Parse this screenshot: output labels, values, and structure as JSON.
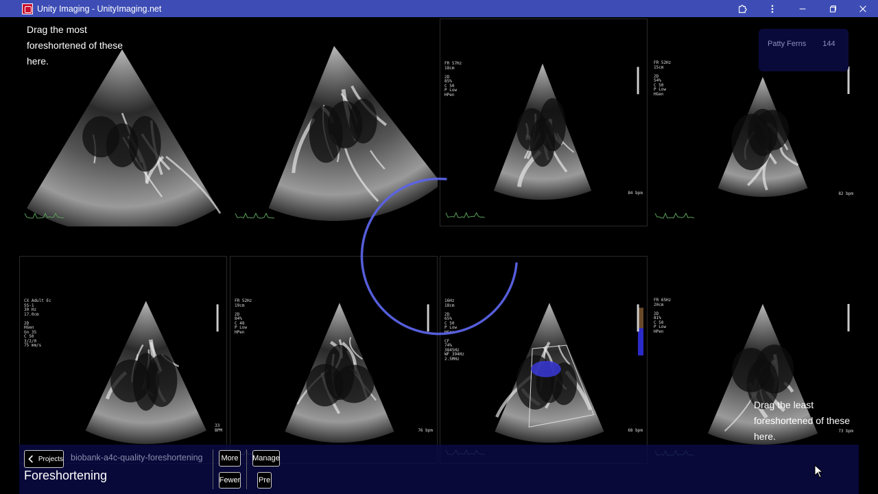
{
  "window": {
    "title": "Unity Imaging - UnityImaging.net",
    "buttons": [
      "extensions-icon",
      "more-vert-icon",
      "minimize-icon",
      "maximize-icon",
      "close-icon"
    ]
  },
  "hints": {
    "top": "Drag the most foreshortened of these here.",
    "bottom": "Drag the least foreshortened of these here."
  },
  "user": {
    "name": "Patty Ferns",
    "count": "144"
  },
  "tiles": [
    {
      "id": 1,
      "readout": "",
      "bpm": ""
    },
    {
      "id": 2,
      "readout": "",
      "bpm": ""
    },
    {
      "id": 3,
      "readout": "FR 57Hz\n18cm\n\n2D\n85%\nC 50\nP Low\nHPen",
      "bpm": "84 bpm"
    },
    {
      "id": 4,
      "readout": "FR 52Hz\n15cm\n\n2D\n54%\nC 50\nP Low\nHGen",
      "bpm": "82 bpm"
    },
    {
      "id": 5,
      "readout": "CX Adult Ec\nSS-1\n30 Hz\n17.0cm\n\n2D\nHGen\nGn 35\nC 50\n3/2/0\n75 mm/s",
      "bpm": "33\nBPM"
    },
    {
      "id": 6,
      "readout": "FR 52Hz\n19cm\n\n2D\n84%\nC 48\nP Low\nHPen",
      "bpm": "76 bpm"
    },
    {
      "id": 7,
      "readout": "16Hz\n18cm\n\n2D\n65%\nC 50\nP Low\nHGen\n\nCF\n74%\n3845Hz\nWF 394Hz\n2.5MHz",
      "bpm": "68 bpm"
    },
    {
      "id": 8,
      "readout": "FR 65Hz\n20cm\n\n2D\n81%\nC 50\nP Low\nHPen",
      "bpm": "73 bpm"
    }
  ],
  "footer": {
    "projects_label": "Projects",
    "dataset": "biobank-a4c-quality-foreshortening",
    "page_title": "Foreshortening",
    "more_label": "More",
    "fewer_label": "Fewer",
    "manage_label": "Manage",
    "pre_label": "Pre"
  },
  "colors": {
    "titlebar": "#3d4db5",
    "spinner": "#5b63e6",
    "footer_bg": "#0a0a46"
  }
}
